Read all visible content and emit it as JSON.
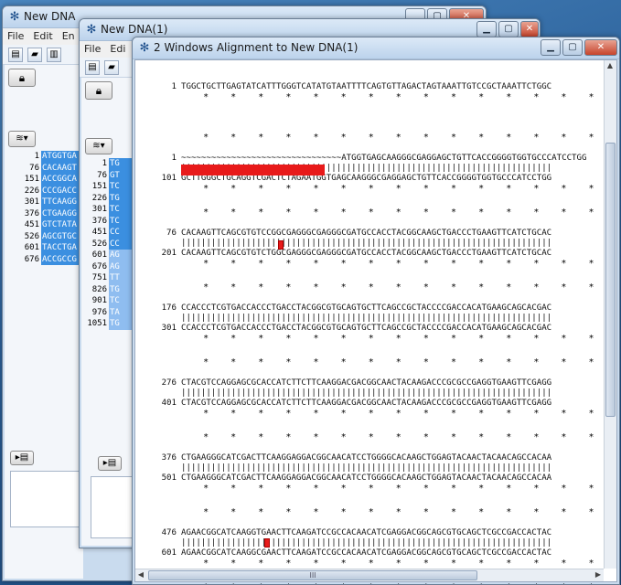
{
  "windows": {
    "back": {
      "title": "New DNA",
      "menu": [
        "File",
        "Edit",
        "En"
      ],
      "numbers": [
        "1",
        "76",
        "151",
        "226",
        "301",
        "376",
        "451",
        "526",
        "601",
        "676"
      ],
      "seqs": [
        "ATGGTGA",
        "CACAAGT",
        "ACCGGCA",
        "CCCGACC",
        "TTCAAGG",
        "CTGAAGG",
        "GTCTATA",
        "AGCGTGC",
        "TACCTGA",
        "ACCGCCG"
      ]
    },
    "middle": {
      "title": "New DNA(1)",
      "menu": [
        "File",
        "Edi"
      ],
      "numbers": [
        "1",
        "76",
        "151",
        "226",
        "301",
        "376",
        "451",
        "526",
        "601",
        "676",
        "751",
        "826",
        "901",
        "976",
        "1051"
      ],
      "seqs": [
        "TG",
        "GT",
        "TC",
        "TG",
        "TC",
        "TC",
        "CC",
        "CC",
        "AG",
        "AG",
        "TT",
        "TG",
        "TC",
        "TA",
        "TG"
      ]
    },
    "front": {
      "title": "2 Windows Alignment to New DNA(1)",
      "scroll_label": "III"
    }
  },
  "alignment": {
    "blocks": [
      {
        "top_num": "",
        "top_seq": "",
        "bottom_num": "1",
        "bottom_seq": "TGGCTGCTTGAGTATCATTTGGGTCATATGTAATTTTCAGTGTTAGACTAGTAAATTGTCCGCTAAATTCTGGC"
      },
      {
        "top_num": "1",
        "top_seq": "~~~~~~~~~~~~~~~~~~~~~~~~~~~~~~~~ATGGTGAGCAAGGGCGAGGAGCTGTTCACCGGGGTGGTGCCCATCCTGG",
        "bottom_num": "101",
        "bottom_seq": "GCTTGGGCTGCAGGTCGACTCTAGAATGGTGAGCAAGGGCGAGGAGCTGTTCACCGGGGTGGTGCCCATCCTGG"
      },
      {
        "top_num": "76",
        "top_seq": "CACAAGTTCAGCGTGTCCGGCGAGGGCGAGGGCGATGCCACCTACGGCAAGCTGACCCTGAAGTTCATCTGCAC",
        "bottom_num": "201",
        "bottom_seq": "CACAAGTTCAGCGTGTCTGGCGAGGGCGAGGGCGATGCCACCTACGGCAAGCTGACCCTGAAGTTCATCTGCAC"
      },
      {
        "top_num": "176",
        "top_seq": "CCACCCTCGTGACCACCCTGACCTACGGCGTGCAGTGCTTCAGCCGCTACCCCGACCACATGAAGCAGCACGAC",
        "bottom_num": "301",
        "bottom_seq": "CCACCCTCGTGACCACCCTGACCTACGGCGTGCAGTGCTTCAGCCGCTACCCCGACCACATGAAGCAGCACGAC"
      },
      {
        "top_num": "276",
        "top_seq": "CTACGTCCAGGAGCGCACCATCTTCTTCAAGGACGACGGCAACTACAAGACCCGCGCCGAGGTGAAGTTCGAGG",
        "bottom_num": "401",
        "bottom_seq": "CTACGTCCAGGAGCGCACCATCTTCTTCAAGGACGACGGCAACTACAAGACCCGCGCCGAGGTGAAGTTCGAGG"
      },
      {
        "top_num": "376",
        "top_seq": "CTGAAGGGCATCGACTTCAAGGAGGACGGCAACATCCTGGGGCACAAGCTGGAGTACAACTACAACAGCCACAA",
        "bottom_num": "501",
        "bottom_seq": "CTGAAGGGCATCGACTTCAAGGAGGACGGCAACATCCTGGGGCACAAGCTGGAGTACAACTACAACAGCCACAA"
      },
      {
        "top_num": "476",
        "top_seq": "AGAACGGCATCAAGGTGAACTTCAAGATCCGCCACAACATCGAGGACGGCAGCGTGCAGCTCGCCGACCACTAC",
        "bottom_num": "601",
        "bottom_seq": "AGAACGGCATCAAGGCGAACTTCAAGATCCGCCACAACATCGAGGACGGCAGCGTGCAGCTCGCCGACCACTAC"
      }
    ]
  },
  "colors": {
    "selection": "#3b8fe0",
    "mismatch": "#e81a1a"
  }
}
